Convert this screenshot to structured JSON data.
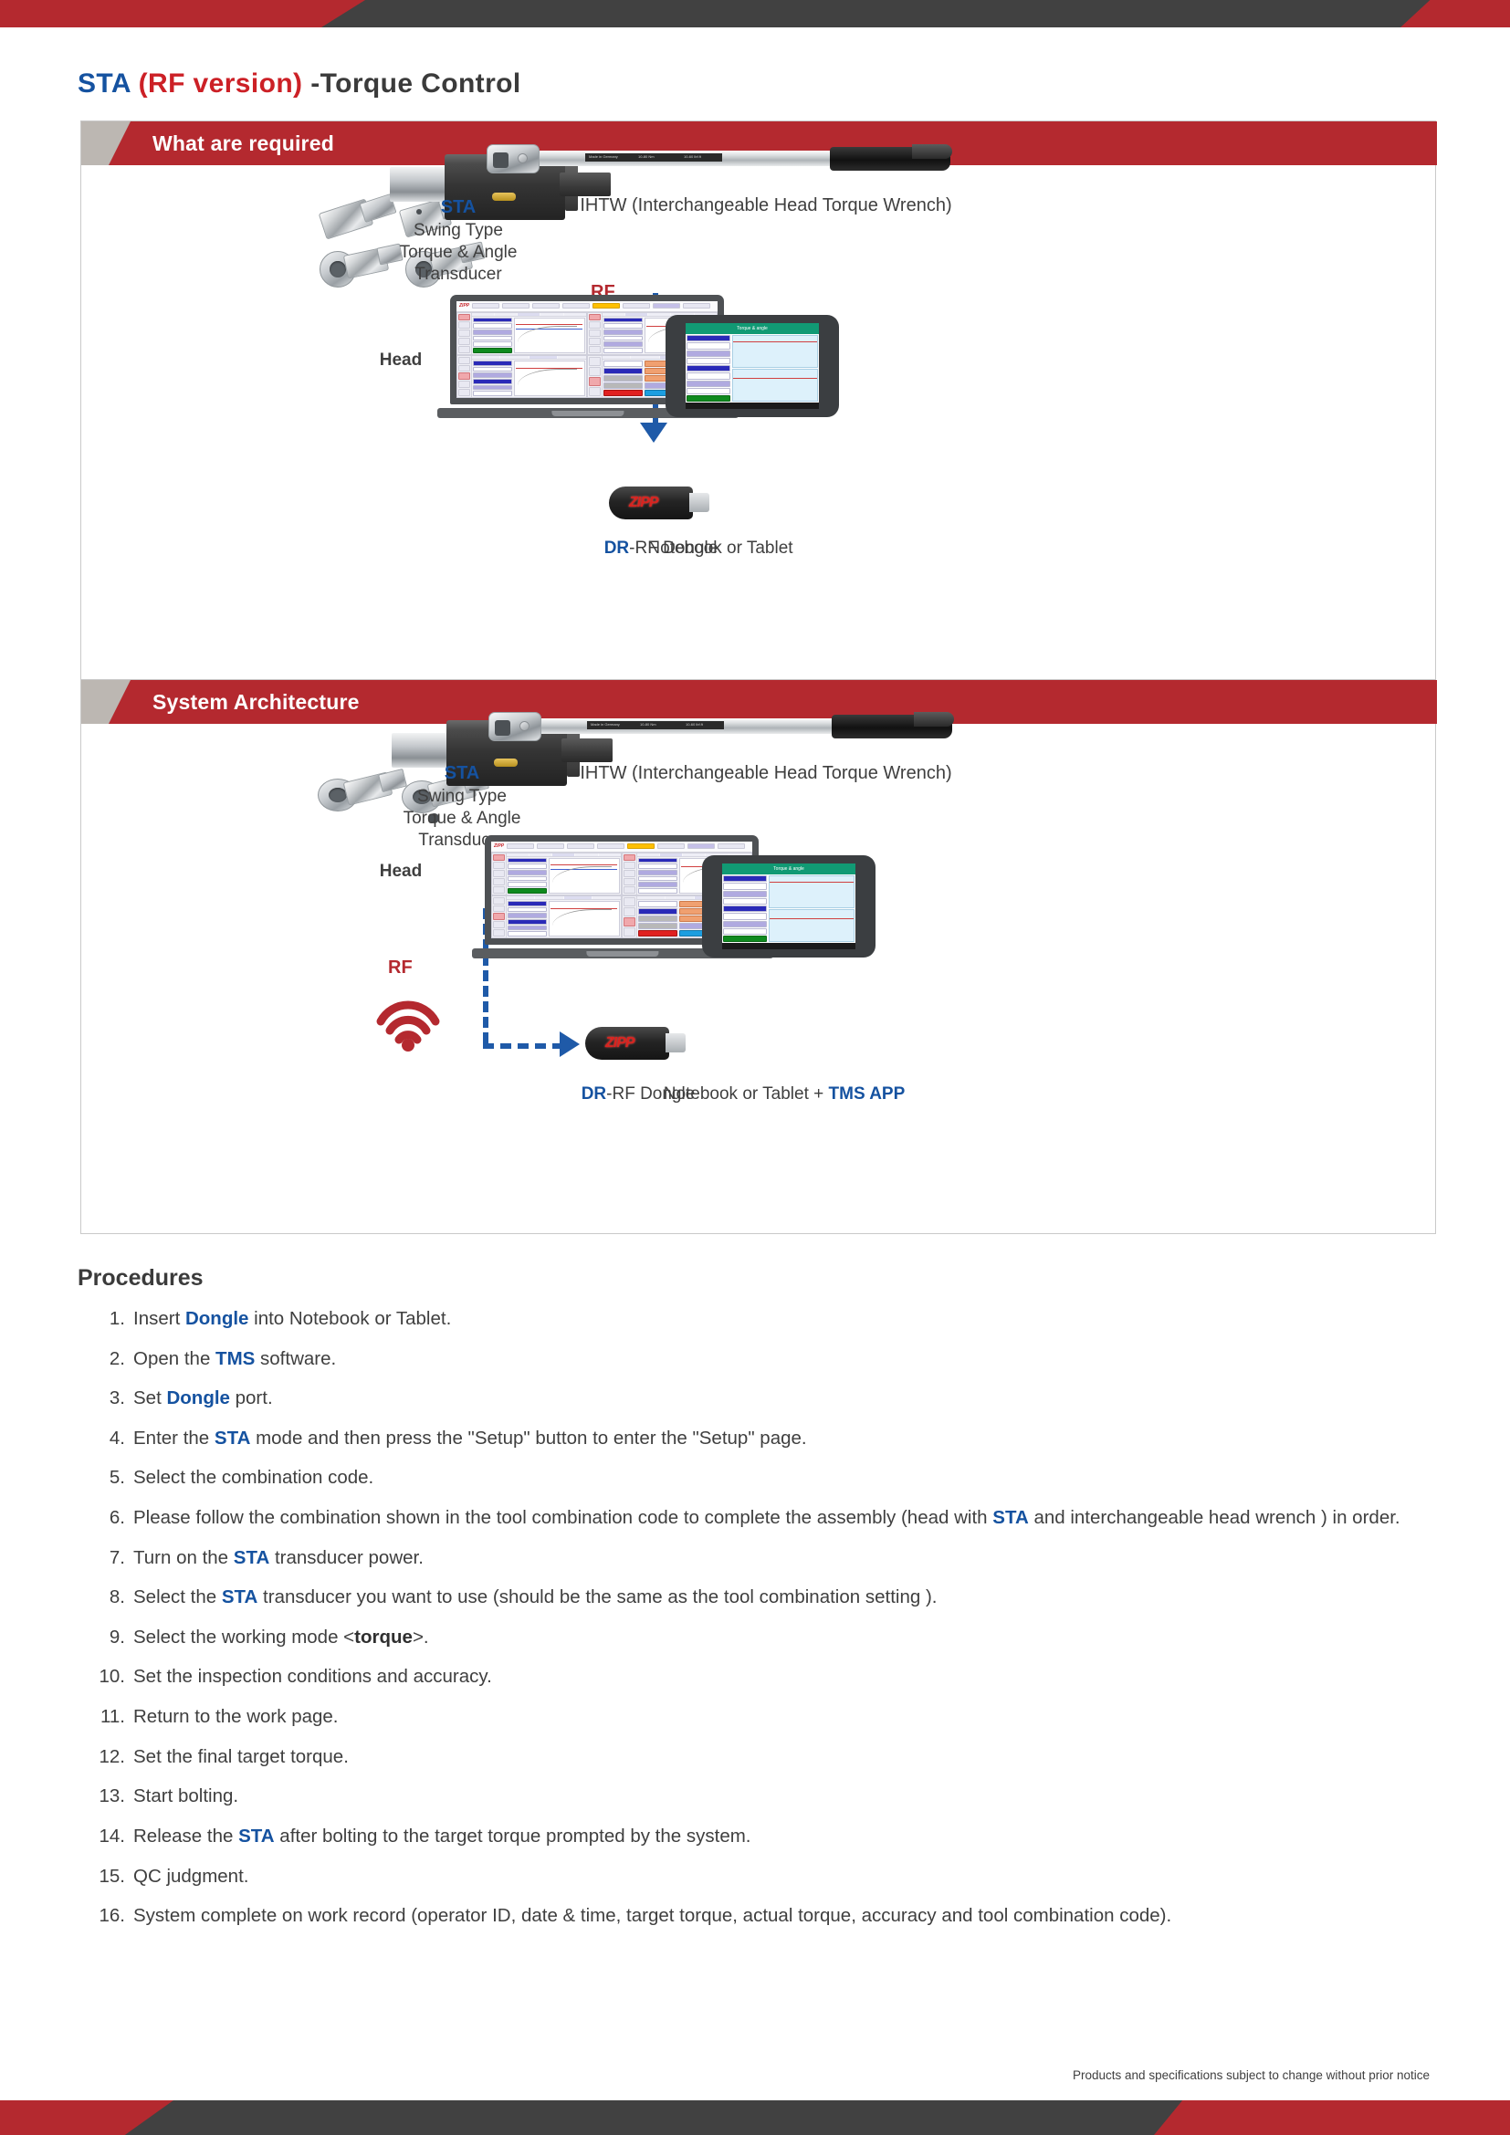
{
  "document": {
    "title_parts": {
      "sta": "STA",
      "rf": "(RF version)",
      "rest": "-Torque Control"
    },
    "footer_note": "Products and specifications subject to change without prior notice"
  },
  "sections": [
    {
      "id": "what-are-required",
      "label": "What are required",
      "head_caption": "Head",
      "sta": {
        "name": "STA",
        "line1": "Swing Type",
        "line2": "Torque & Angle",
        "line3": "Transducer"
      },
      "wrench_caption": "IHTW (Interchangeable Head Torque Wrench)",
      "wrench_plate": {
        "left": "Made in Germany",
        "mid": "10-80 Nm",
        "right": "10-60 lbf.ft"
      },
      "rf_label": "RF",
      "dongle_caption_blue": "DR",
      "dongle_caption_rest": "-RF Dongle",
      "dongle_logo": "ZIPP",
      "device_caption": "Notebook or Tablet"
    },
    {
      "id": "system-architecture",
      "label": "System Architecture",
      "head_caption": "Head",
      "sta": {
        "name": "STA",
        "line1": "Swing Type",
        "line2": "Torque & Angle",
        "line3": "Transducer"
      },
      "wrench_caption": "IHTW (Interchangeable Head Torque Wrench)",
      "wrench_plate": {
        "left": "Made in Germany",
        "mid": "10-80 Nm",
        "right": "10-60 lbf.ft"
      },
      "rf_label": "RF",
      "dongle_caption_blue": "DR",
      "dongle_caption_rest": "-RF Dongle",
      "dongle_logo": "ZIPP",
      "device_caption_plain": "Notebook or Tablet + ",
      "device_caption_app": "TMS APP"
    }
  ],
  "software_screen": {
    "logo": "ZIPP",
    "panels": [
      {
        "fields": [
          "Target torque",
          "100  Nm",
          "Actual torque",
          "98.53  Nm",
          "0",
          "OK"
        ]
      },
      {
        "fields": [
          "Target torque",
          "75  Nm",
          "Actual torque",
          "68.18  Nm",
          "Number",
          "20"
        ]
      },
      {
        "fields": [
          "Target torque",
          "80  Nm",
          "77.81  Nm",
          "Target angle",
          "20  °",
          "15.2",
          "Torque+"
        ]
      },
      {
        "fields": [
          "Submodel",
          "120",
          "Unit",
          "Nm",
          "Tolerance(+/-)",
          "+/-  10",
          "Actual torque",
          "103  Nm",
          "Static",
          "0 / 3"
        ]
      }
    ]
  },
  "tablet_app": {
    "app_title": "Torque & angle",
    "rows": [
      {
        "label": "Target torque",
        "value": "75.0"
      },
      {
        "label": "Actual torque",
        "value": "76.64"
      },
      {
        "label": "Target angle",
        "value": "15.0 °"
      },
      {
        "label": "Actual angle",
        "value": "16.50 °"
      },
      {
        "label": "Torque",
        "value": ""
      }
    ],
    "status": "OK"
  },
  "procedures": {
    "title": "Procedures",
    "items": [
      {
        "num": "1.",
        "parts": [
          {
            "t": "Insert "
          },
          {
            "t": "Dongle",
            "s": "kw"
          },
          {
            "t": " into Notebook or Tablet."
          }
        ]
      },
      {
        "num": "2.",
        "parts": [
          {
            "t": "Open the "
          },
          {
            "t": "TMS",
            "s": "kw"
          },
          {
            "t": " software."
          }
        ]
      },
      {
        "num": "3.",
        "parts": [
          {
            "t": "Set "
          },
          {
            "t": "Dongle",
            "s": "kw"
          },
          {
            "t": " port."
          }
        ]
      },
      {
        "num": "4.",
        "parts": [
          {
            "t": "Enter the "
          },
          {
            "t": "STA",
            "s": "kw"
          },
          {
            "t": " mode and then press the \"Setup\" button to enter the \"Setup\" page."
          }
        ]
      },
      {
        "num": "5.",
        "parts": [
          {
            "t": "Select the combination code."
          }
        ]
      },
      {
        "num": "6.",
        "parts": [
          {
            "t": "Please follow the combination shown in the tool combination code to complete the assembly (head with "
          },
          {
            "t": "STA",
            "s": "kw"
          },
          {
            "t": " and interchangeable head wrench ) in order."
          }
        ]
      },
      {
        "num": "7.",
        "parts": [
          {
            "t": "Turn on the "
          },
          {
            "t": "STA",
            "s": "kw"
          },
          {
            "t": " transducer power."
          }
        ]
      },
      {
        "num": "8.",
        "parts": [
          {
            "t": "Select the "
          },
          {
            "t": "STA",
            "s": "kw"
          },
          {
            "t": " transducer you want to use (should be the same as the tool combination setting )."
          }
        ]
      },
      {
        "num": "9.",
        "parts": [
          {
            "t": "Select the working mode <"
          },
          {
            "t": "torque",
            "s": "bk"
          },
          {
            "t": ">."
          }
        ]
      },
      {
        "num": "10.",
        "parts": [
          {
            "t": "Set the inspection conditions and accuracy."
          }
        ]
      },
      {
        "num": "11.",
        "parts": [
          {
            "t": "Return to the work page."
          }
        ]
      },
      {
        "num": "12.",
        "parts": [
          {
            "t": "Set the final target torque."
          }
        ]
      },
      {
        "num": "13.",
        "parts": [
          {
            "t": "Start bolting."
          }
        ]
      },
      {
        "num": "14.",
        "parts": [
          {
            "t": "Release the "
          },
          {
            "t": "STA",
            "s": "kw"
          },
          {
            "t": " after bolting to the target torque prompted by the system."
          }
        ]
      },
      {
        "num": "15.",
        "parts": [
          {
            "t": "QC judgment."
          }
        ]
      },
      {
        "num": "16.",
        "parts": [
          {
            "t": "System complete on work record (operator ID, date & time, target torque, actual torque, accuracy and tool combination code)."
          }
        ]
      }
    ]
  },
  "colors": {
    "brand_red": "#b4292f",
    "brand_blue": "#1552a0",
    "dark_band": "#414141",
    "grey_tab": "#bcb7b2"
  }
}
